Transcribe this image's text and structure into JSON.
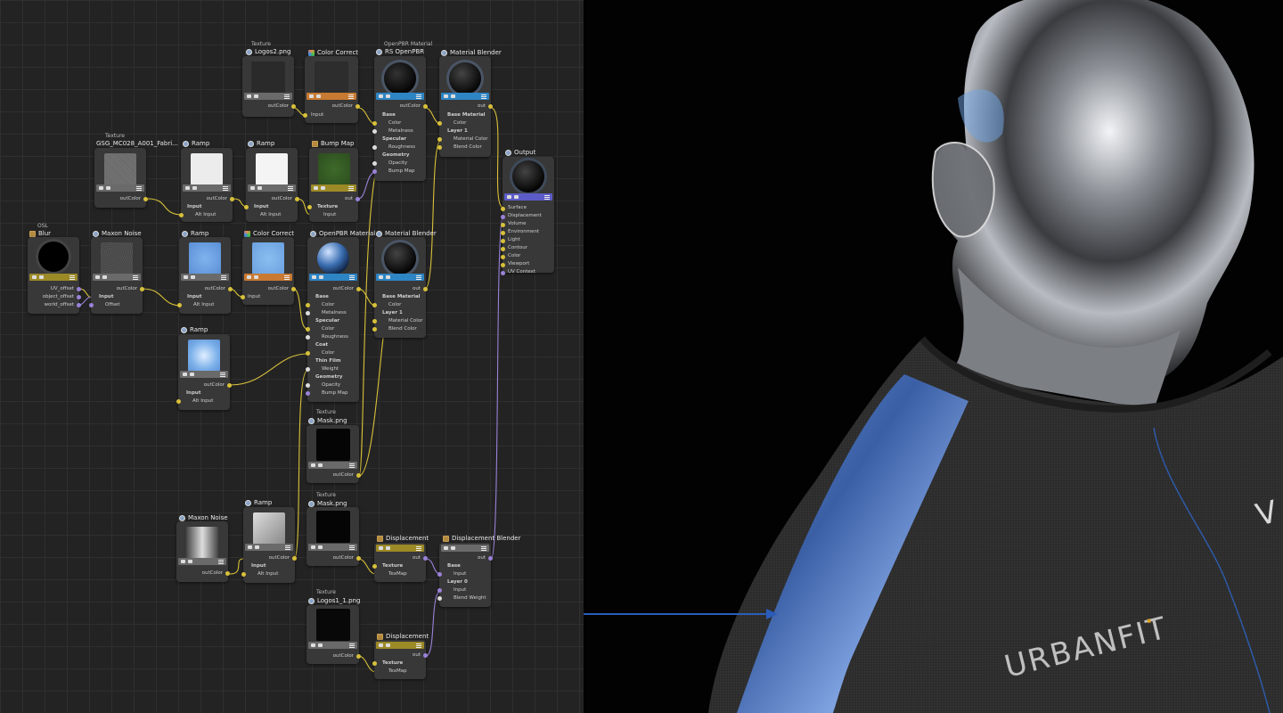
{
  "nodes": {
    "tex_logos2": {
      "subtitle": "Texture",
      "title": "Logos2.png",
      "port_out": "outColor"
    },
    "cc1": {
      "title": "Color Correct",
      "port_out": "outColor",
      "port_in": "Input"
    },
    "openpbr1": {
      "subtitle": "OpenPBR Material",
      "title": "RS OpenPBR",
      "port_out": "outColor",
      "inputs": [
        "Base",
        "Color",
        "Metalness",
        "Specular",
        "Roughness",
        "Geometry",
        "Opacity",
        "Bump Map"
      ]
    },
    "blender1": {
      "title": "Material Blender",
      "port_out": "out",
      "inputs": [
        "Base Material",
        "Color",
        "Layer 1",
        "Material Color",
        "Blend Color"
      ]
    },
    "tex_fabric": {
      "subtitle": "Texture",
      "title": "GSG_MC028_A001_Fabri...",
      "port_out": "outColor"
    },
    "ramp1": {
      "title": "Ramp",
      "port_out": "outColor",
      "inputs": [
        "Input",
        "Alt Input"
      ]
    },
    "ramp2": {
      "title": "Ramp",
      "port_out": "outColor",
      "inputs": [
        "Input",
        "Alt Input"
      ]
    },
    "bump": {
      "title": "Bump Map",
      "port_out": "out",
      "inputs": [
        "Texture",
        "Input"
      ]
    },
    "output": {
      "title": "Output",
      "inputs": [
        "Surface",
        "Displacement",
        "Volume",
        "Environment",
        "Light",
        "Contour",
        "Color",
        "Viewport",
        "UV Context"
      ]
    },
    "osl_blur": {
      "subtitle": "OSL",
      "title": "Blur",
      "ports_out": [
        "UV_offset",
        "object_offset",
        "world_offset"
      ]
    },
    "maxon_noise1": {
      "title": "Maxon Noise",
      "port_out": "outColor",
      "inputs": [
        "Input",
        "Offset"
      ]
    },
    "ramp3": {
      "title": "Ramp",
      "port_out": "outColor",
      "inputs": [
        "Input",
        "Alt Input"
      ]
    },
    "cc2": {
      "title": "Color Correct",
      "port_out": "outColor",
      "port_in": "Input"
    },
    "openpbr2": {
      "title": "OpenPBR Material",
      "port_out": "outColor",
      "inputs": [
        "Base",
        "Color",
        "Metalness",
        "Specular",
        "Color",
        "Roughness",
        "Coat",
        "Color",
        "Thin Film",
        "Weight",
        "Geometry",
        "Opacity",
        "Bump Map"
      ]
    },
    "blender2": {
      "title": "Material Blender",
      "port_out": "out",
      "inputs": [
        "Base Material",
        "Color",
        "Layer 1",
        "Material Color",
        "Blend Color"
      ]
    },
    "ramp4": {
      "title": "Ramp",
      "port_out": "outColor",
      "inputs": [
        "Input",
        "Alt Input"
      ]
    },
    "tex_mask1": {
      "subtitle": "Texture",
      "title": "Mask.png",
      "port_out": "outColor"
    },
    "maxon_noise2": {
      "title": "Maxon Noise",
      "port_out": "outColor"
    },
    "ramp5": {
      "title": "Ramp",
      "port_out": "outColor",
      "inputs": [
        "Input",
        "Alt Input"
      ]
    },
    "tex_mask2": {
      "subtitle": "Texture",
      "title": "Mask.png",
      "port_out": "outColor"
    },
    "disp1": {
      "title": "Displacement",
      "port_out": "out",
      "inputs": [
        "Texture",
        "TexMap"
      ]
    },
    "disp_blender": {
      "title": "Displacement Blender",
      "port_out": "out",
      "inputs": [
        "Base",
        "Input",
        "Layer 0",
        "Input",
        "Blend Weight"
      ]
    },
    "tex_logos1": {
      "subtitle": "Texture",
      "title": "Logos1_1.png",
      "port_out": "outColor"
    },
    "disp2": {
      "title": "Displacement",
      "port_out": "out",
      "inputs": [
        "Texture",
        "TexMap"
      ]
    }
  },
  "render": {
    "shirt_logo": "URBANFIT",
    "logo_dot": "."
  },
  "colors": {
    "canvas": "#232323",
    "node": "#383838",
    "wire_yellow": "#d8c13a",
    "wire_purple": "#9a82d8",
    "arrow": "#2a5cb8"
  }
}
